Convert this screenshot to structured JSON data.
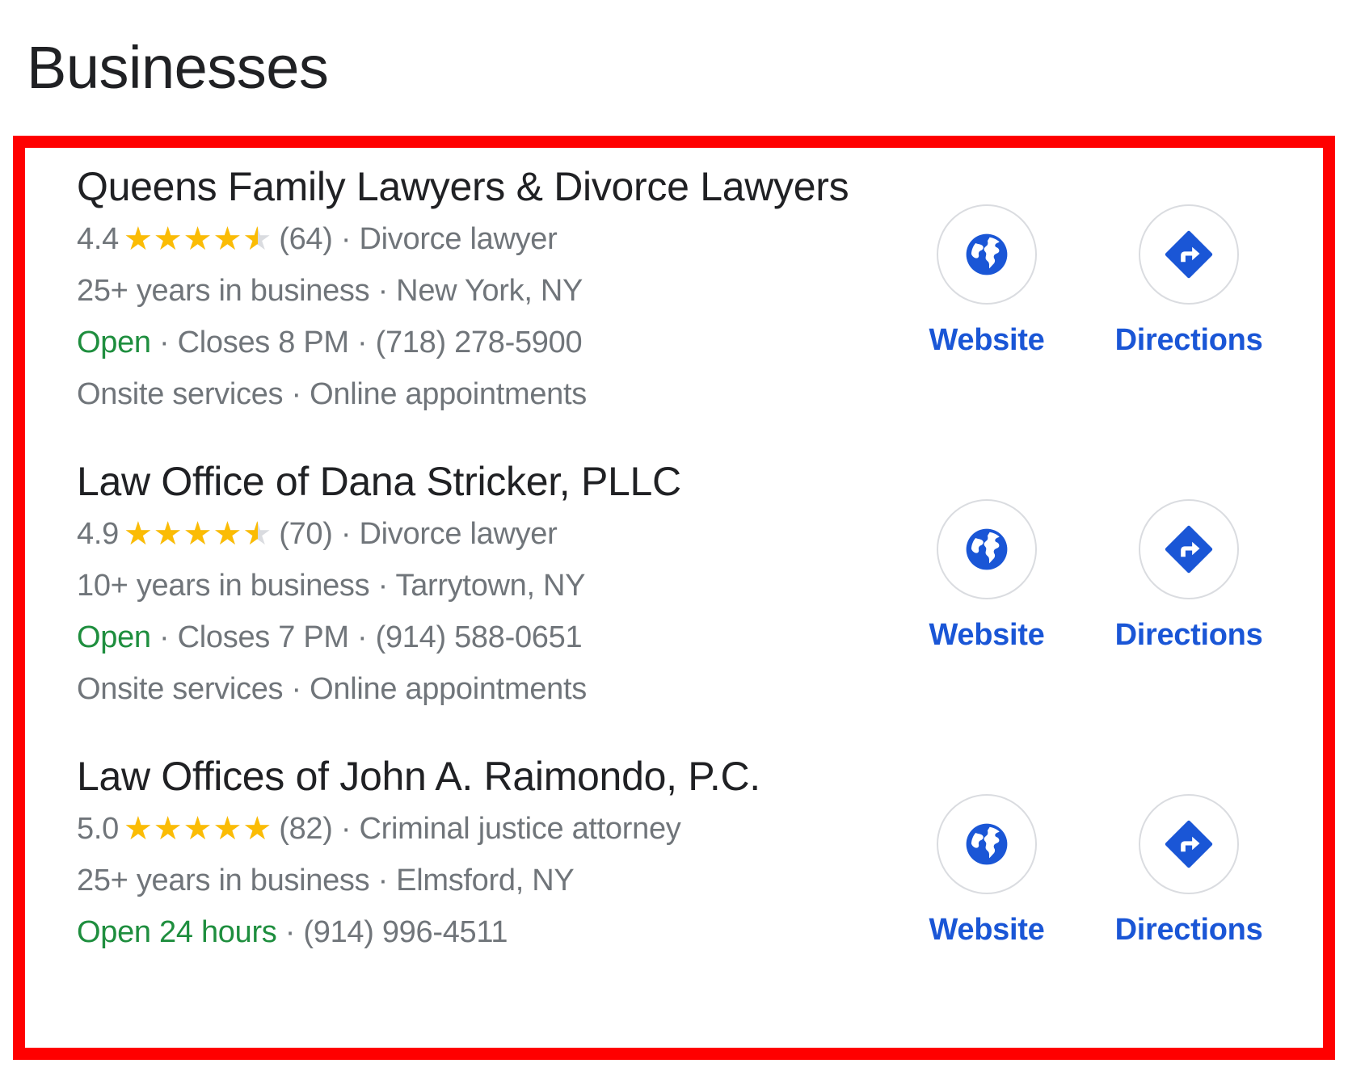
{
  "page": {
    "heading": "Businesses"
  },
  "colors": {
    "highlight_border": "#ff0000",
    "star": "#fbbc04",
    "open": "#1e8e3e",
    "action": "#1a56d6",
    "secondary_text": "#70757a"
  },
  "listings": [
    {
      "name": "Queens Family Lawyers & Divorce Lawyers",
      "rating": "4.4",
      "rating_value": 4.4,
      "reviews": "(64)",
      "category": "· Divorce lawyer",
      "details": "25+ years in business · New York, NY",
      "status": "Open",
      "hours_phone": "· Closes 8 PM · (718) 278-5900",
      "services": "Onsite services · Online appointments",
      "website_label": "Website",
      "website_icon": "globe-icon",
      "directions_label": "Directions",
      "directions_icon": "directions-icon"
    },
    {
      "name": "Law Office of Dana Stricker, PLLC",
      "rating": "4.9",
      "rating_value": 4.9,
      "reviews": "(70)",
      "category": "· Divorce lawyer",
      "details": "10+ years in business · Tarrytown, NY",
      "status": "Open",
      "hours_phone": "· Closes 7 PM · (914) 588-0651",
      "services": "Onsite services · Online appointments",
      "website_label": "Website",
      "website_icon": "globe-icon",
      "directions_label": "Directions",
      "directions_icon": "directions-icon"
    },
    {
      "name": "Law Offices of John A. Raimondo, P.C.",
      "rating": "5.0",
      "rating_value": 5.0,
      "reviews": "(82)",
      "category": "· Criminal justice attorney",
      "details": "25+ years in business · Elmsford, NY",
      "status": "Open 24 hours",
      "hours_phone": "· (914) 996-4511",
      "services": "",
      "website_label": "Website",
      "website_icon": "globe-icon",
      "directions_label": "Directions",
      "directions_icon": "directions-icon"
    }
  ]
}
